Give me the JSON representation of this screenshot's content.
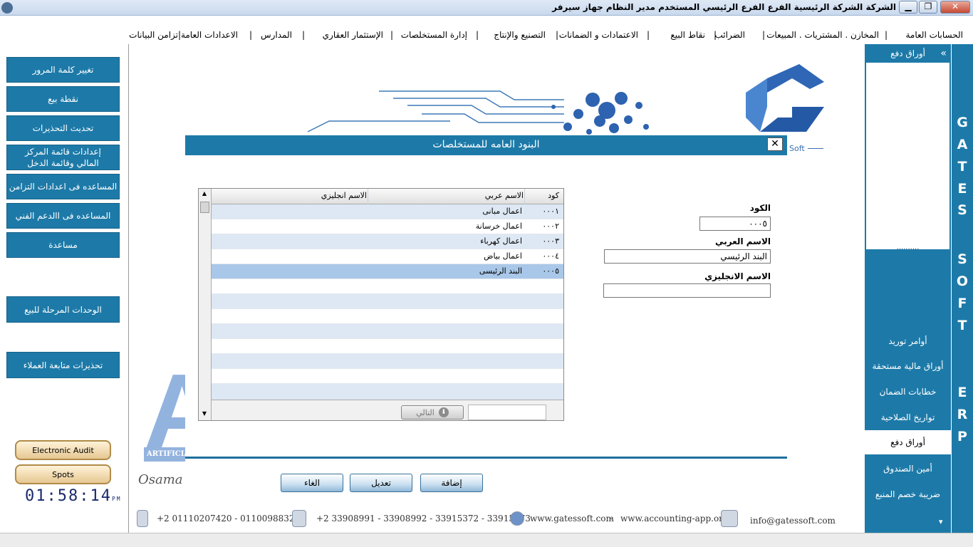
{
  "titlebar": {
    "title": "الشركة الشركة الرئيسية   الفرع الفرع الرئيسي   المستخدم مدير النظام   جهاز سيرفر",
    "min": "▁",
    "max": "❐",
    "close": "✕"
  },
  "menu": {
    "items": [
      "الحسابات العامة",
      "المخازن . المشتريات . المبيعات",
      "الضرائب",
      "نقاط البيع",
      "الاعتمادات و الضمانات",
      "التصنيع والإنتاج",
      "إدارة المستخلصات",
      "الإستثمار العقاري",
      "المدارس",
      "الاعدادات العامة",
      "تزامن البيانات"
    ],
    "separator": "|"
  },
  "left_panel": {
    "buttons": [
      "تغيير كلمة المرور",
      "نقطة بيع",
      "تحديث التحذيرات",
      "إعدادات قائمة المركز المالي وقائمة الدخل",
      "المساعده فى اعدادات التزامن",
      "المساعده فى االدعم الفني",
      "مساعدة",
      "الوحدات المرحلة للبيع",
      "تحذيرات متابعة العملاء"
    ],
    "electronic_audit": "Electronic Audit",
    "spots": "Spots",
    "clock": "01:58:14",
    "clock_suffix": "PM"
  },
  "logo": {
    "soft_text": "Soft",
    "left_letter": "A",
    "left_caption": "ARTIFICIA",
    "signature": "Osama S"
  },
  "dialog": {
    "title": "البنود العامه للمستخلصات",
    "close": "✕",
    "grid": {
      "columns": {
        "code": "كود",
        "arabic": "الاسم عربي",
        "english": "الاسم انجليزي"
      },
      "rows": [
        {
          "code": "٠٠٠١",
          "arabic": "اعمال مبانى",
          "english": ""
        },
        {
          "code": "٠٠٠٢",
          "arabic": "اعمال خرسانة",
          "english": ""
        },
        {
          "code": "٠٠٠٣",
          "arabic": "اعمال كهرباء",
          "english": ""
        },
        {
          "code": "٠٠٠٤",
          "arabic": "اعمال بياض",
          "english": ""
        },
        {
          "code": "٠٠٠٥",
          "arabic": "البند الرئيسى",
          "english": ""
        }
      ],
      "next_label": "التالي",
      "pager_value": ""
    },
    "form": {
      "code_label": "الكود",
      "code_value": "٠٠٠٥",
      "arabic_label": "الاسم العربي",
      "arabic_value": "البند الرئيسي",
      "english_label": "الاسم الانجليزي",
      "english_value": ""
    },
    "actions": {
      "add": "إضافة",
      "edit": "تعديل",
      "cancel": "الغاء"
    }
  },
  "footer": {
    "mobile": "+2 01110207420  - 01100988327",
    "phone": "+2 33908991 - 33908992 - 33915372 - 33915373",
    "website1": "www.gatessoft.com",
    "dash": "-",
    "website2": "www.accounting-app.org",
    "email": "info@gatessoft.com"
  },
  "right_panel": {
    "header": "أوراق دفع",
    "collapse": "»",
    "dots": "..........",
    "items": [
      "أوامر توريد",
      "أوراق مالية مستحقة",
      "خطابات الضمان",
      "تواريخ الصلاحية",
      "أوراق دفع",
      "أمين الصندوق",
      "ضريبة خصم المنبع"
    ],
    "active_item": "أوراق دفع",
    "scroll_down": "▾"
  },
  "brand_strip": {
    "letters": [
      "G",
      "A",
      "T",
      "E",
      "S",
      "S",
      "O",
      "F",
      "T",
      "E",
      "R",
      "P"
    ]
  },
  "colors": {
    "accent": "#1d7aa8",
    "selected_row": "#a9c7e8",
    "alt_row": "#dde8f4"
  }
}
